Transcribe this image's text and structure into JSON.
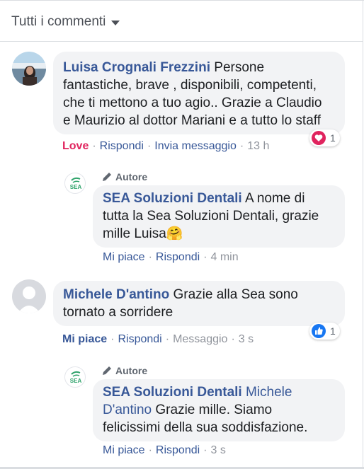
{
  "header": {
    "sort_label": "Tutti i commenti"
  },
  "comments": [
    {
      "author": "Luisa Crognali Frezzini",
      "text": "Persone fantastiche, brave , disponibili, competenti, che ti mettono a tuo agio.. Grazie a Claudio e Maurizio al dottor Mariani e a tutto lo staff",
      "line1_rest": "Persone",
      "line2": "fantastiche, brave , disponibili, competenti,",
      "line3": "che ti mettono a tuo agio.. Grazie a Claudio",
      "line4": "e Maurizio al dottor Mariani e a tutto lo staff",
      "reaction_count": "1",
      "actions": {
        "reaction": "Love",
        "reply": "Rispondi",
        "message": "Invia messaggio",
        "time": "13 h"
      },
      "reply": {
        "badge": "Autore",
        "author": "SEA Soluzioni Dentali",
        "line1_rest": "A nome di",
        "line2": "tutta la Sea Soluzioni Dentali, grazie",
        "line3": "mille Luisa",
        "emoji": "🤗",
        "actions": {
          "like": "Mi piace",
          "reply": "Rispondi",
          "time": "4 min"
        }
      }
    },
    {
      "author": "Michele D'antino",
      "line1_rest": "Grazie alla Sea sono",
      "line2": "tornato a sorridere",
      "reaction_count": "1",
      "actions": {
        "like": "Mi piace",
        "reply": "Rispondi",
        "message": "Messaggio",
        "time": "3 s"
      },
      "reply": {
        "badge": "Autore",
        "author": "SEA Soluzioni Dentali",
        "tag_line1": "Michele",
        "tag_line2": "D'antino",
        "line2_rest": "Grazie mille. Siamo",
        "line3": "felicissimi della sua soddisfazione.",
        "actions": {
          "like": "Mi piace",
          "reply": "Rispondi",
          "time": "3 s"
        }
      }
    }
  ],
  "logo_text": "SEA",
  "colors": {
    "link": "#385898",
    "bubble": "#f2f3f5",
    "love": "#e0245e",
    "like_blue": "#1877f2",
    "meta": "#90949c"
  }
}
